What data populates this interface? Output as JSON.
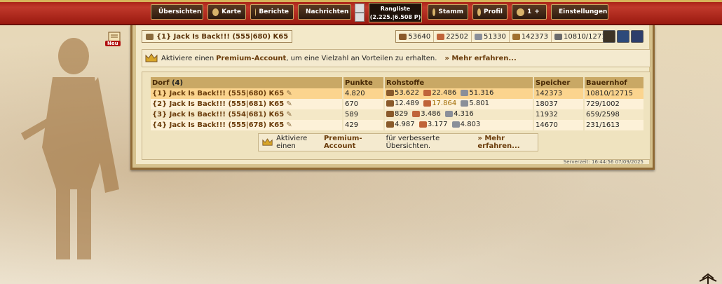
{
  "nav": {
    "overview": "Übersichten",
    "map": "Karte",
    "reports": "Berichte",
    "messages": "Nachrichten",
    "ranking_label": "Rangliste",
    "ranking_value": "(2.225.|6.508 P)",
    "tribe": "Stamm",
    "profile": "Profil",
    "friends_count": "1",
    "friends_plus": "+",
    "settings": "Einstellungen"
  },
  "new_badge": "Neu",
  "village": {
    "title": "{1} Jack Is Back!!! (555|680) K65"
  },
  "resources": {
    "wood": "53640",
    "clay": "22502",
    "iron": "51330",
    "storage": "142373",
    "farm": "10810/12715"
  },
  "premium_top": {
    "text_before": "Aktiviere einen",
    "highlight": "Premium-Account",
    "text_after": ", um eine Vielzahl an Vorteilen zu erhalten.",
    "more": "» Mehr erfahren..."
  },
  "table": {
    "headers": {
      "village": "Dorf",
      "village_count": "(4)",
      "points": "Punkte",
      "resources": "Rohstoffe",
      "storage": "Speicher",
      "farm": "Bauernhof"
    },
    "rows": [
      {
        "name": "{1} Jack Is Back!!! (555|680) K65",
        "points": "4.820",
        "wood": "53.622",
        "clay": "22.486",
        "iron": "51.316",
        "storage": "142373",
        "farm": "10810/12715"
      },
      {
        "name": "{2} Jack Is Back!!! (555|681) K65",
        "points": "670",
        "wood": "12.489",
        "clay": "17.864",
        "iron": "5.801",
        "storage": "18037",
        "farm": "729/1002"
      },
      {
        "name": "{3} Jack Is Back!!! (554|681) K65",
        "points": "589",
        "wood": "829",
        "clay": "3.486",
        "iron": "4.316",
        "storage": "11932",
        "farm": "659/2598"
      },
      {
        "name": "{4} Jack Is Back!!! (555|678) K65",
        "points": "429",
        "wood": "4.987",
        "clay": "3.177",
        "iron": "4.803",
        "storage": "14670",
        "farm": "231/1613"
      }
    ]
  },
  "premium_bottom": {
    "text_before": "Aktiviere einen",
    "highlight": "Premium-Account",
    "text_after": "für verbesserte Übersichten.",
    "more": "» Mehr erfahren..."
  },
  "server_time": "Serverzeit: 16:44:56 07/09/2025",
  "colors": {
    "topbar": "#b52a1c",
    "accent": "#6a3c0b",
    "row_highlight": "#fbd48e"
  }
}
